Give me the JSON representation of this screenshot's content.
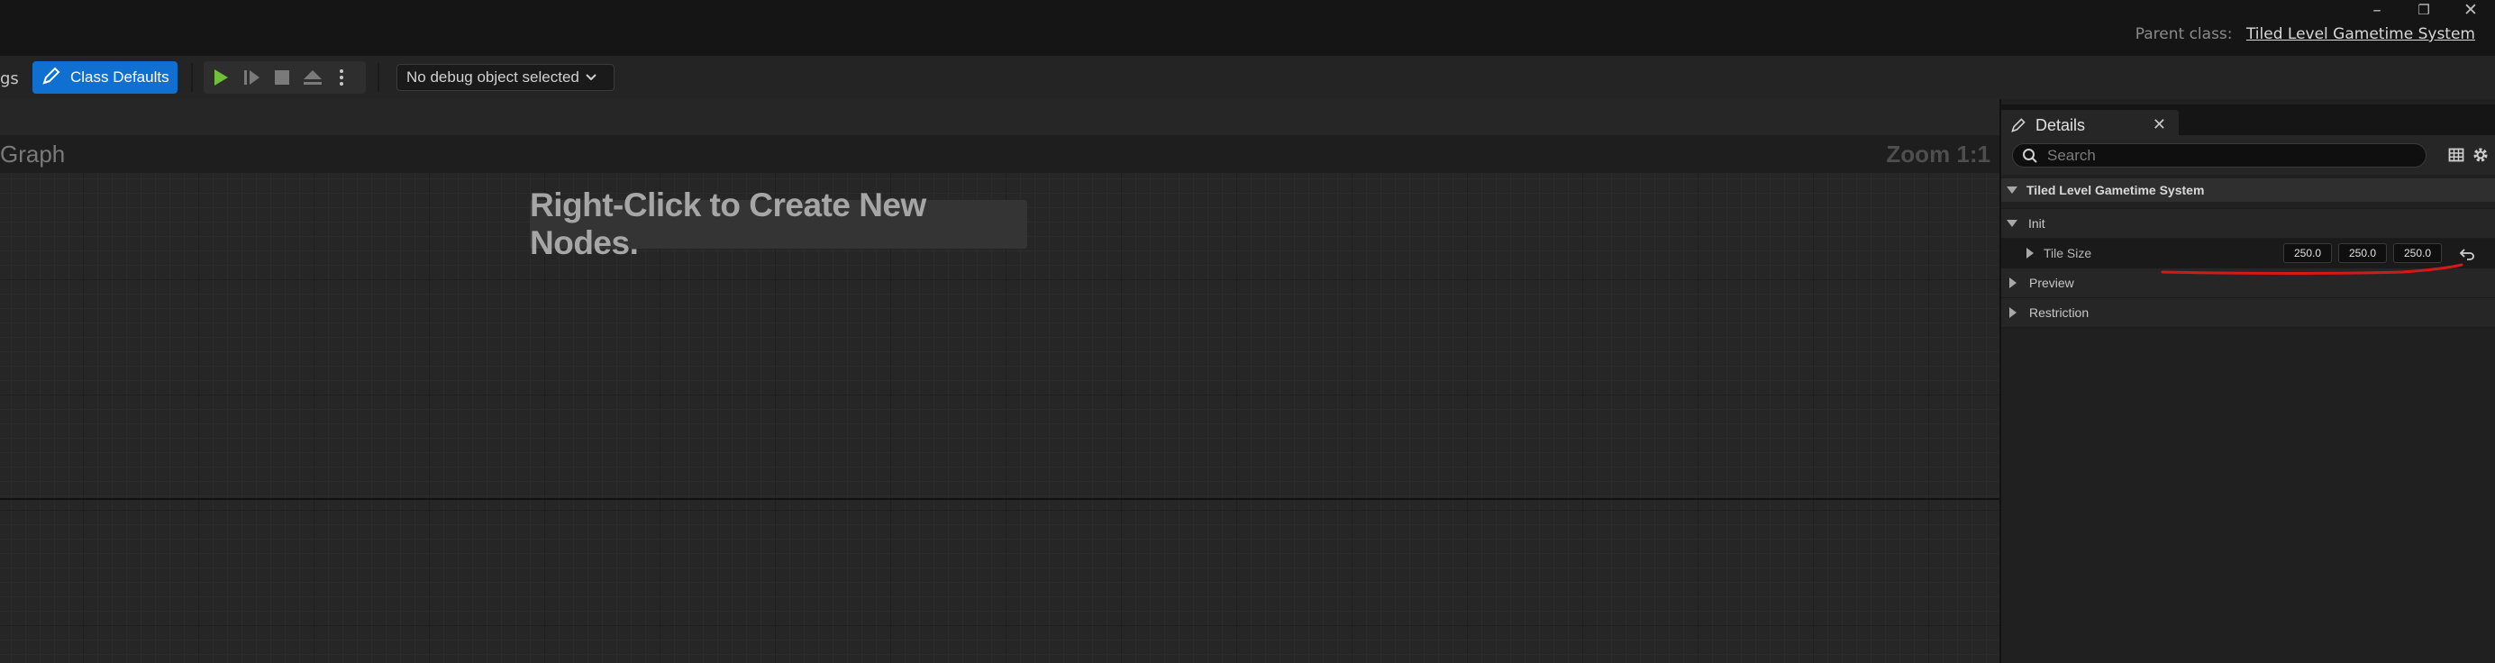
{
  "window": {
    "minimize_glyph": "–",
    "restore_glyph": "❐",
    "close_glyph": "✕",
    "parent_class_label": "Parent class:",
    "parent_class_value": "Tiled Level Gametime System"
  },
  "toolbar": {
    "cut_tab_text": "gs",
    "class_defaults_label": "Class Defaults",
    "play_controls": [
      "play-icon",
      "step-icon",
      "stop-icon",
      "eject-icon",
      "more-options-icon"
    ],
    "debug_object_label": "No debug object selected",
    "accent_color": "#0f70d1",
    "play_color": "#6fbf3a"
  },
  "graph": {
    "title": "Graph",
    "zoom": "Zoom 1:1",
    "hint": "Right-Click to Create New Nodes."
  },
  "details": {
    "tab_label": "Details",
    "search_placeholder": "Search",
    "category": "Tiled Level Gametime System",
    "init_label": "Init",
    "tile_size_label": "Tile Size",
    "tile_size": {
      "x": "250.0",
      "y": "250.0",
      "z": "250.0"
    },
    "preview_label": "Preview",
    "restriction_label": "Restriction",
    "annotation_color": "#d11a1a"
  }
}
